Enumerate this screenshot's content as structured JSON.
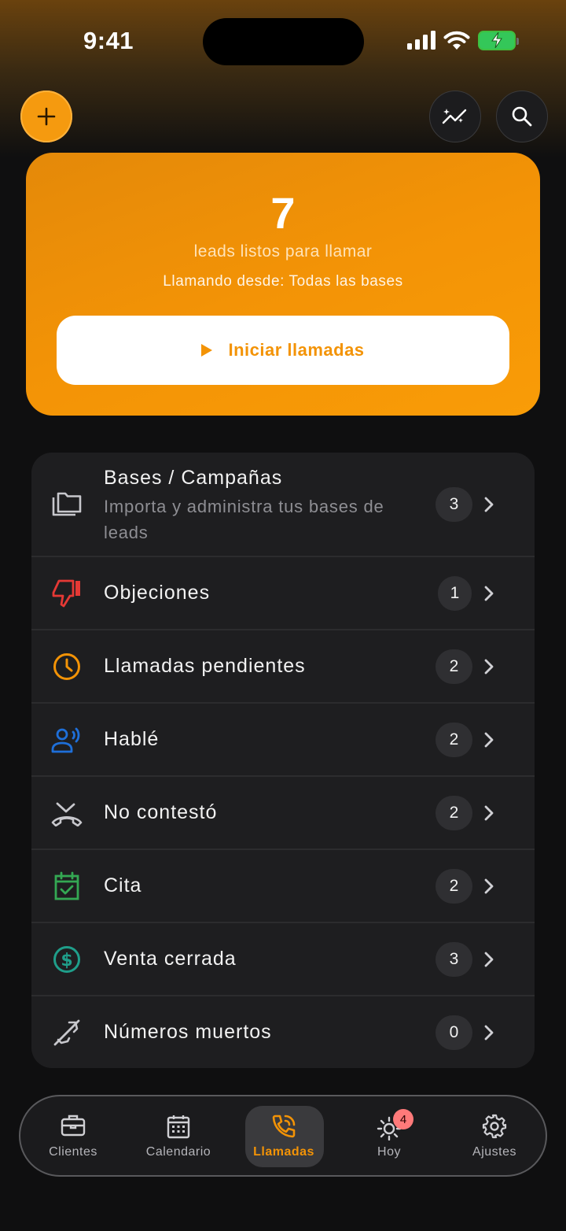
{
  "status_bar": {
    "time": "9:41"
  },
  "hero": {
    "count": "7",
    "subtitle": "leads listos para llamar",
    "calling_from": "Llamando desde: Todas las bases",
    "start_button": "Iniciar llamadas"
  },
  "colors": {
    "accent": "#f39306",
    "card_bg": "#1e1e20",
    "background": "#0f0f10"
  },
  "menu": [
    {
      "label": "Bases / Campañas",
      "description": "Importa y administra tus bases de leads",
      "count": "3",
      "icon": "folders-icon",
      "icon_color": "#c7c7cc"
    },
    {
      "label": "Objeciones",
      "count": "1",
      "icon": "thumbs-down-icon",
      "icon_color": "#e53935"
    },
    {
      "label": "Llamadas pendientes",
      "count": "2",
      "icon": "clock-icon",
      "icon_color": "#f39306"
    },
    {
      "label": "Hablé",
      "count": "2",
      "icon": "person-speaking-icon",
      "icon_color": "#1e6fd9"
    },
    {
      "label": "No contestó",
      "count": "2",
      "icon": "missed-call-icon",
      "icon_color": "#c7c7cc"
    },
    {
      "label": "Cita",
      "count": "2",
      "icon": "calendar-check-icon",
      "icon_color": "#34a853"
    },
    {
      "label": "Venta cerrada",
      "count": "3",
      "icon": "dollar-circle-icon",
      "icon_color": "#1f9e8a"
    },
    {
      "label": "Números muertos",
      "count": "0",
      "icon": "phone-disabled-icon",
      "icon_color": "#c7c7cc"
    }
  ],
  "tabs": [
    {
      "label": "Clientes",
      "icon": "briefcase-icon"
    },
    {
      "label": "Calendario",
      "icon": "calendar-icon"
    },
    {
      "label": "Llamadas",
      "icon": "phone-call-icon",
      "active": true
    },
    {
      "label": "Hoy",
      "icon": "sun-icon",
      "badge": "4"
    },
    {
      "label": "Ajustes",
      "icon": "gear-icon"
    }
  ]
}
